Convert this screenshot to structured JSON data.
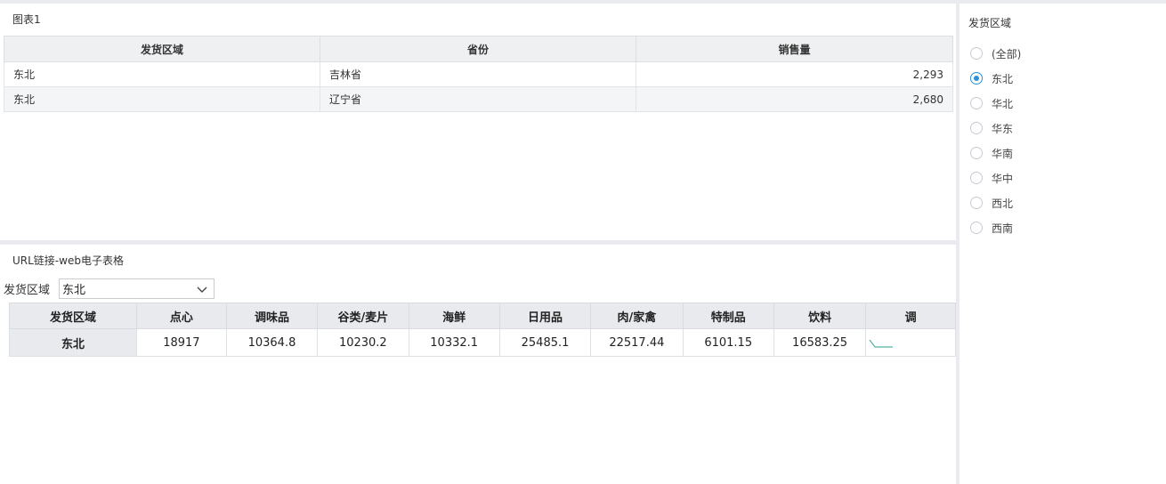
{
  "chart1": {
    "title": "图表1",
    "columns": [
      "发货区域",
      "省份",
      "销售量"
    ],
    "rows": [
      [
        "东北",
        "吉林省",
        "2,293"
      ],
      [
        "东北",
        "辽宁省",
        "2,680"
      ]
    ]
  },
  "webtable": {
    "title": "URL链接-web电子表格",
    "filter_label": "发货区域",
    "filter_value": "东北",
    "columns": [
      "发货区域",
      "点心",
      "调味品",
      "谷类/麦片",
      "海鲜",
      "日用品",
      "肉/家禽",
      "特制品",
      "饮料",
      "调"
    ],
    "row": [
      "东北",
      "18917",
      "10364.8",
      "10230.2",
      "10332.1",
      "25485.1",
      "22517.44",
      "6101.15",
      "16583.25"
    ]
  },
  "filter": {
    "title": "发货区域",
    "options": [
      "(全部)",
      "东北",
      "华北",
      "华东",
      "华南",
      "华中",
      "西北",
      "西南"
    ],
    "selected": "东北"
  },
  "colors": {
    "accent": "#2f8fd8",
    "sparkline": "#2a9d8f"
  }
}
